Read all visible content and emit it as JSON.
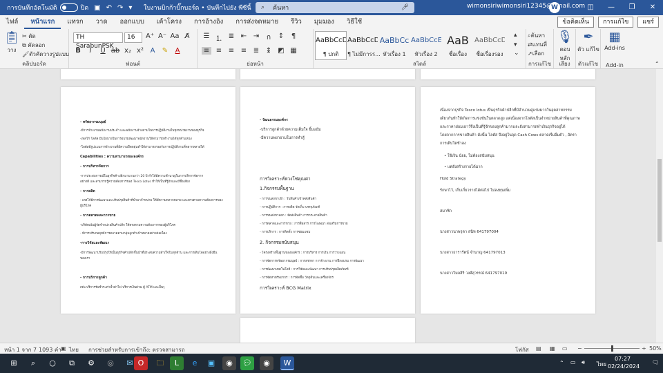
{
  "titlebar": {
    "autosave_label": "การบันทึกอัตโนมัติ",
    "autosave_state": "ปิด",
    "doc_title": "ใบงานบิกก้าบิ๊กบอร์ด • บันทึกไปยัง พีซีนี้",
    "search_placeholder": "ค้นหา",
    "user_email": "wimonsiriwimonsiri12345@gmail.com",
    "avatar_letter": "W"
  },
  "tabs": [
    "ไฟล์",
    "หน้าแรก",
    "แทรก",
    "วาด",
    "ออกแบบ",
    "เค้าโครง",
    "การอ้างอิง",
    "การส่งจดหมาย",
    "รีวิว",
    "มุมมอง",
    "วิธีใช้"
  ],
  "active_tab": "หน้าแรก",
  "tab_actions": {
    "comments": "ข้อคิดเห็น",
    "editing": "การแก้ไข",
    "share": "แชร์"
  },
  "ribbon": {
    "clipboard": {
      "paste": "วาง",
      "cut": "ตัด",
      "copy": "คัดลอก",
      "format_painter": "ตัวคัดวางรูปแบบ",
      "label": "คลิปบอร์ด"
    },
    "font": {
      "name": "TH SarabunPSK",
      "size": "16",
      "label": "ฟอนต์"
    },
    "paragraph": {
      "label": "ย่อหน้า"
    },
    "styles": {
      "label": "สไตล์",
      "items": [
        {
          "sample": "AaBbCcDd",
          "name": "¶ ปกติ"
        },
        {
          "sample": "AaBbCcDd",
          "name": "¶ ไม่มีการร..."
        },
        {
          "sample": "AaBbCc",
          "name": "หัวเรื่อง 1"
        },
        {
          "sample": "AaBbCcE",
          "name": "หัวเรื่อง 2"
        },
        {
          "sample": "AaB",
          "name": "ชื่อเรื่อง"
        },
        {
          "sample": "AaBbCcDd",
          "name": "ชื่อเรื่องรอง"
        }
      ]
    },
    "editing": {
      "find": "ค้นหา",
      "replace": "แทนที่",
      "select": "เลือก",
      "label": "การแก้ไข"
    },
    "voice": {
      "dictate": "ตอบ หลัก",
      "label": "เสียง"
    },
    "sensitivity": {
      "editor": "ตัว แก้ไข",
      "label": "ตัวแก้ไข"
    },
    "addins": {
      "addins": "Add-ins",
      "label": "Add-in"
    }
  },
  "pages": {
    "page1": {
      "lines": [
        {
          "text": "- ทรัพยากรมนุษย์",
          "style": "h"
        },
        {
          "text": "-มีการจ้างงานพนักงานประจำ และพนักงานจ้างตามในการปฏิบัติงานในทุกหน่วยงานของธุรกิจ",
          "style": ""
        },
        {
          "text": "-เทสโก้ โลตัส มีนโยบายในการอบรมพัฒนาพนักงานให้สามารถทำงานได้ทุกตำแหน่ง",
          "style": ""
        },
        {
          "text": "-โลตัสมีรูปแบบการจ้างงานที่มีความยืดหยุ่นทำให้สามารถรองรับการปฏิบัติงานที่หลากหลายได้",
          "style": ""
        },
        {
          "text": "Capabilities : ความสามารถขององค์กร",
          "style": "h"
        },
        {
          "text": "- การบริหารจัดการ",
          "style": "h"
        },
        {
          "text": "-การประสบการณ์ในธุรกิจค้าปลีกมานานกว่า 20 ปี ทำให้มีความชำนาญในการบริหารจัดการ",
          "style": ""
        },
        {
          "text": "อย่างดี และสามารถรู้ความต้องการของ Tesco Lotus ทำให้เป็นที่รู้จักและมีชื่อเสียง",
          "style": ""
        },
        {
          "text": "- การผลิต",
          "style": "h"
        },
        {
          "text": "- เทสโก้มีการพัฒนาและปรับปรุงสินค้าที่นำมาจำหน่าย ให้มีความหลากหลาย และตรงตามความต้องการของ",
          "style": ""
        },
        {
          "text": "ผู้บริโภค",
          "style": ""
        },
        {
          "text": "- การตลาดและการขาย",
          "style": "h"
        },
        {
          "text": "-บริษัทเน้นผู้จัดจำหน่ายสินค้าปลีก ให้ตรงตามความต้องการของผู้บริโภค",
          "style": ""
        },
        {
          "text": "- มีการปรับกลยุทธ์การตลาดตามกลุ่มลูกค้าเป้าหมายอย่างต่อเนื่อง",
          "style": ""
        },
        {
          "text": "-การวิจัยและพัฒนา",
          "style": "h"
        },
        {
          "text": "-มีการพัฒนาปรับปรุงให้เป็นธุรกิจค้าปลีกชั้นนำที่ประสบความสำเร็จในทุกด้าน และการเติบโตอย่างยั่งยืน",
          "style": ""
        },
        {
          "text": "ของเรา",
          "style": ""
        },
        {
          "text": "- การบริการลูกค้า",
          "style": "h"
        },
        {
          "text": "เช่น บริการรับชำระค่าน้ำค่าไฟ บริการเงินด่วน ตู้ ATM และอื่นๆ",
          "style": ""
        }
      ]
    },
    "page2": {
      "lines": [
        {
          "text": "- วัฒนธรรมองค์กร",
          "style": "h"
        },
        {
          "text": "-บริการลูกค้าด้วยความเต็มใจ ยิ้มแย้ม",
          "style": "med"
        },
        {
          "text": "-มีความพยายามในการทำสู้",
          "style": "med"
        },
        {
          "text": "การวิเคราะห์ห่วงโซ่คุณค่า",
          "style": "big"
        },
        {
          "text": "1.กิจกรรมพื้นฐาน",
          "style": "big"
        },
        {
          "text": "- การขนส่งขาเข้า : รับสินค้าเข้าคลังสินค้า",
          "style": ""
        },
        {
          "text": "- การปฏิบัติการ : การผลิต จัดเก็บ บรรจุภัณฑ์",
          "style": ""
        },
        {
          "text": "- การขนส่งขาออก : จัดส่งสินค้า การกระจายสินค้า",
          "style": ""
        },
        {
          "text": "- การตลาดและการขาย : การสื่อสาร การโฆษณา ส่งเสริมการขาย",
          "style": ""
        },
        {
          "text": "- การบริการ : การติดตั้ง การซ่อมแซม",
          "style": ""
        },
        {
          "text": "2. กิจกรรมสนับสนุน",
          "style": "big"
        },
        {
          "text": "- โครงสร้างพื้นฐานขององค์กร : การบริหาร การเงิน การวางแผน",
          "style": ""
        },
        {
          "text": "- การจัดการทรัพยากรมนุษย์ : การสรรหา การจ้างงาน การฝึกอบรม การพัฒนา",
          "style": ""
        },
        {
          "text": "- การพัฒนาเทคโนโลยี : การวิจัยและพัฒนา การปรับปรุงผลิตภัณฑ์",
          "style": ""
        },
        {
          "text": "- การจัดหาทรัพยากร : การจัดซื้อ วัตถุดิบและเครื่องจักร",
          "style": ""
        },
        {
          "text": "การวิเคราะห์ BCG Matrix",
          "style": "big"
        }
      ]
    },
    "page3": {
      "para1": [
        "เนื่องจากธุรกิจ Tesco lotus เป็นธุรกิจค้าปลีกที่มีจำนวนคู่แข่งมากในอุตสาหกรรม",
        "เดียวกันทำให้เกิดการแข่งขันในตลาดสูง แต่เนื่องจากโลตัสเป็นจำหน่ายสินค้าที่คุณภาพ",
        "และราคาย่อมเยาว์จึงเป็นที่รู้จักของลูกค้ามากและยังสามารถทำเงินธุรกิจอยู่ได้",
        "โดยจากการขายสินค้า ดังนั้น โลตัส จึงอยู่ในจุด Cash Cows ตลาดเริ่มอิ่มตัว , อัตรา",
        "การเติบโตช้าลง"
      ],
      "bullets": [
        "ใช้เงิน น้อย, ไม่ต้องสนับสนุน",
        "แต่ยังสร้างรายได้มาก"
      ],
      "strategy_title": "Hold Strategy",
      "strategy_text": "รักษาไว้, เก็บเกี่ยวรายได้ต่อไป ไม่ลงทุนเพิ่ม",
      "members_title": "สมาชิก",
      "members": [
        "นางสาวนาพรุดา สนิท 641797004",
        "นางสาวธารารัตน์ จำนาญ 641797013",
        "นางสาววิมลสิริ วงศ์สุวรรณ์ 641797019"
      ]
    }
  },
  "statusbar": {
    "page": "หน้า 1 จาก 7",
    "words": "1093 คำ",
    "lang": "ไทย",
    "accessibility": "การช่วยสำหรับการเข้าถึง: ตรวจสามารถ",
    "focus": "โฟกัส",
    "zoom": "50%",
    "zoom_level": 0.5
  },
  "taskbar": {
    "time": "07:27",
    "date": "02/24/2024",
    "lang": "ไทย"
  },
  "colors": {
    "word_blue": "#2b579a",
    "taskbar": "#1f2a36"
  }
}
